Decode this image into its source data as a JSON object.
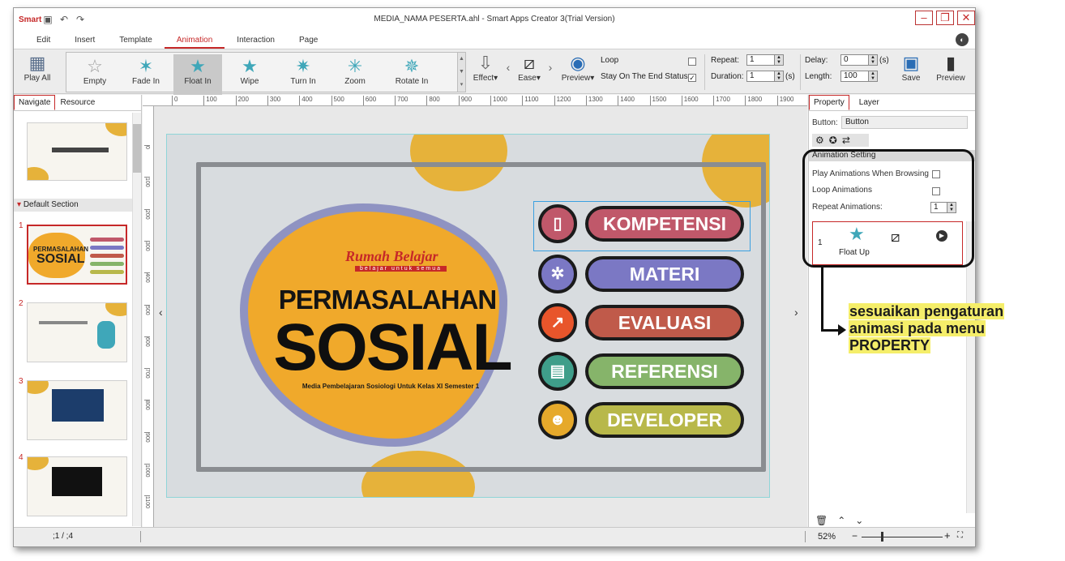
{
  "window": {
    "logo": "Smart",
    "title": "MEDIA_NAMA PESERTA.ahl - Smart Apps Creator 3(Trial Version)",
    "controls": [
      "–",
      "❐",
      "✕"
    ]
  },
  "menu": {
    "items": [
      "Edit",
      "Insert",
      "Template",
      "Animation",
      "Interaction",
      "Page"
    ],
    "active": "Animation"
  },
  "ribbon": {
    "play_all": "Play All",
    "effects": [
      "Empty",
      "Fade In",
      "Float In",
      "Wipe",
      "Turn In",
      "Zoom",
      "Rotate In"
    ],
    "selected_effect": "Float In",
    "effect_label": "Effect",
    "ease_label": "Ease",
    "preview_dropdown": "Preview",
    "loop_label": "Loop",
    "stay_label": "Stay On The End Status",
    "repeat_label": "Repeat:",
    "repeat_value": "1",
    "duration_label": "Duration:",
    "duration_value": "1",
    "duration_unit": "(s)",
    "delay_label": "Delay:",
    "delay_value": "0",
    "delay_unit": "(s)",
    "length_label": "Length:",
    "length_value": "100",
    "save_label": "Save",
    "preview_label": "Preview"
  },
  "left_panel": {
    "tabs": [
      "Navigate",
      "Resource"
    ],
    "section_label": "Default Section",
    "slide_numbers": [
      "1",
      "2",
      "3",
      "4"
    ],
    "thumb_title": "PERMASALAHAN",
    "thumb_sub": "SOSIAL"
  },
  "ruler": {
    "top_ticks": [
      "0",
      "100",
      "200",
      "300",
      "400",
      "500",
      "600",
      "700",
      "800",
      "900",
      "1000",
      "1100",
      "1200",
      "1300",
      "1400",
      "1500",
      "1600",
      "1700",
      "1800",
      "1900"
    ],
    "left_ticks": [
      "0",
      "100",
      "200",
      "300",
      "400",
      "500",
      "600",
      "700",
      "800",
      "900",
      "1000",
      "1100"
    ]
  },
  "slide": {
    "brand": "Rumah Belajar",
    "brand_tag": "belajar untuk semua",
    "title": "PERMASALAHAN",
    "subtitle": "SOSIAL",
    "description": "Media Pembelajaran Sosiologi Untuk Kelas XI Semester 1",
    "menu_buttons": [
      {
        "label": "KOMPETENSI",
        "icon": "document-icon",
        "color": "#c0586a"
      },
      {
        "label": "MATERI",
        "icon": "gear-icon",
        "color": "#7b78c4"
      },
      {
        "label": "EVALUASI",
        "icon": "chart-icon",
        "color": "#c05a4a"
      },
      {
        "label": "REFERENSI",
        "icon": "book-icon",
        "color": "#86b46a"
      },
      {
        "label": "DEVELOPER",
        "icon": "person-icon",
        "color": "#b8b84a"
      }
    ]
  },
  "right_panel": {
    "tabs": [
      "Property",
      "Layer"
    ],
    "button_label": "Button:",
    "button_value": "Button",
    "section_header": "Animation Setting",
    "play_browsing": "Play Animations When Browsing",
    "loop_animations": "Loop Animations",
    "repeat_animations": "Repeat Animations:",
    "repeat_value": "1",
    "anim_index": "1",
    "anim_name": "Float Up"
  },
  "status": {
    "page_indicator": ";1  /  ;4",
    "zoom": "52%"
  },
  "annotation": {
    "lines": [
      "sesuaikan pengaturan",
      "animasi pada menu",
      "PROPERTY"
    ]
  }
}
